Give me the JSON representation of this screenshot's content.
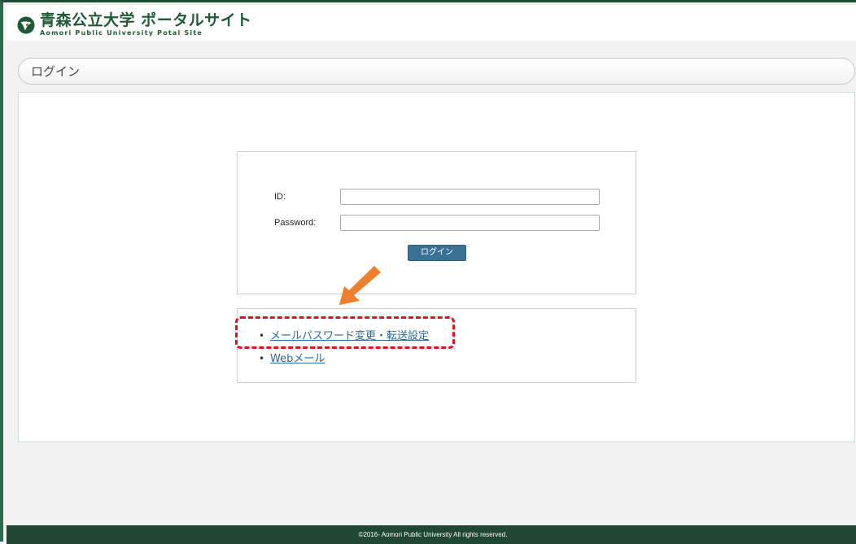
{
  "header": {
    "logo_title": "青森公立大学 ポータルサイト",
    "logo_subtitle": "Aomori Public University Potal Site",
    "brand_color": "#1e5a36"
  },
  "page": {
    "title": "ログイン"
  },
  "login_form": {
    "id_label": "ID:",
    "id_value": "",
    "password_label": "Password:",
    "password_value": "",
    "submit_label": "ログイン",
    "button_color": "#3a7295"
  },
  "links": {
    "items": [
      {
        "label": "メールパスワード変更・転送設定",
        "highlighted": true
      },
      {
        "label": "Webメール",
        "highlighted": false
      }
    ]
  },
  "annotation": {
    "arrow_color": "#f07f2d",
    "highlight_color": "#e0141c",
    "arrow_icon": "arrow-down-left-icon"
  },
  "footer": {
    "copyright": "©2016- Aomori Public University All rights reserved."
  }
}
